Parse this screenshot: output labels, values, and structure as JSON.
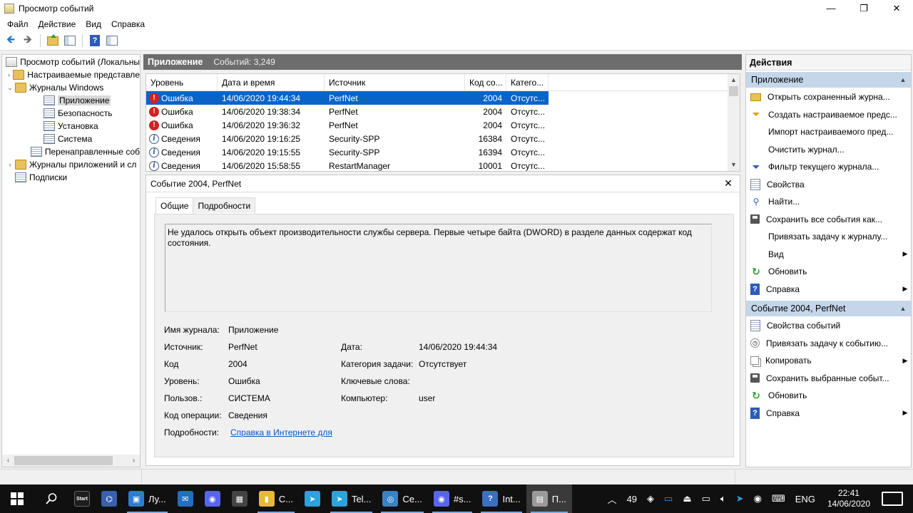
{
  "window": {
    "title": "Просмотр событий",
    "minimize": "—",
    "restore": "❐",
    "close": "✕"
  },
  "menu": [
    "Файл",
    "Действие",
    "Вид",
    "Справка"
  ],
  "toolbar": {
    "back_icon": "arrow-left-icon",
    "forward_icon": "arrow-right-icon",
    "back_glyph": "🡸",
    "forward_glyph": "🡺",
    "help_glyph": "?"
  },
  "tree": {
    "items": [
      {
        "label": "Просмотр событий (Локальны",
        "exp": "",
        "icon": "root",
        "indent": 0
      },
      {
        "label": "Настраиваемые представле",
        "exp": "›",
        "icon": "folder",
        "indent": 1
      },
      {
        "label": "Журналы Windows",
        "exp": "⌄",
        "icon": "folder",
        "indent": 1
      },
      {
        "label": "Приложение",
        "exp": "",
        "icon": "log",
        "indent": 2,
        "selected": true
      },
      {
        "label": "Безопасность",
        "exp": "",
        "icon": "log",
        "indent": 2
      },
      {
        "label": "Установка",
        "exp": "",
        "icon": "log",
        "indent": 2
      },
      {
        "label": "Система",
        "exp": "",
        "icon": "log",
        "indent": 2
      },
      {
        "label": "Перенаправленные соб",
        "exp": "",
        "icon": "log",
        "indent": 2
      },
      {
        "label": "Журналы приложений и сл",
        "exp": "›",
        "icon": "folder",
        "indent": 1
      },
      {
        "label": "Подписки",
        "exp": "",
        "icon": "log",
        "indent": 1
      }
    ],
    "scroll_left": "‹",
    "scroll_right": "›"
  },
  "center": {
    "title": "Приложение",
    "count": "Событий: 3,249"
  },
  "grid": {
    "columns": [
      "Уровень",
      "Дата и время",
      "Источник",
      "Код со...",
      "Катего..."
    ],
    "rows": [
      {
        "level": "Ошибка",
        "type": "err",
        "datetime": "14/06/2020 19:44:34",
        "source": "PerfNet",
        "code": "2004",
        "category": "Отсутс...",
        "selected": true
      },
      {
        "level": "Ошибка",
        "type": "err",
        "datetime": "14/06/2020 19:38:34",
        "source": "PerfNet",
        "code": "2004",
        "category": "Отсутс..."
      },
      {
        "level": "Ошибка",
        "type": "err",
        "datetime": "14/06/2020 19:36:32",
        "source": "PerfNet",
        "code": "2004",
        "category": "Отсутс..."
      },
      {
        "level": "Сведения",
        "type": "info",
        "datetime": "14/06/2020 19:16:25",
        "source": "Security-SPP",
        "code": "16384",
        "category": "Отсутс..."
      },
      {
        "level": "Сведения",
        "type": "info",
        "datetime": "14/06/2020 19:15:55",
        "source": "Security-SPP",
        "code": "16394",
        "category": "Отсутс..."
      },
      {
        "level": "Сведения",
        "type": "info",
        "datetime": "14/06/2020 15:58:55",
        "source": "RestartManager",
        "code": "10001",
        "category": "Отсутс..."
      }
    ],
    "scroll_up": "▲",
    "scroll_down": "▼"
  },
  "detail": {
    "title": "Событие 2004, PerfNet",
    "close": "✕",
    "tabs": [
      "Общие",
      "Подробности"
    ],
    "description": "Не удалось открыть объект производительности службы сервера. Первые четыре байта (DWORD) в разделе данных содержат код состояния.",
    "fields": {
      "log_name_label": "Имя журнала:",
      "log_name": "Приложение",
      "source_label": "Источник:",
      "source": "PerfNet",
      "date_label": "Дата:",
      "date": "14/06/2020 19:44:34",
      "code_label": "Код",
      "code": "2004",
      "task_cat_label": "Категория задачи:",
      "task_cat": "Отсутствует",
      "level_label": "Уровень:",
      "level": "Ошибка",
      "keywords_label": "Ключевые слова:",
      "user_label": "Пользов.:",
      "user": "СИСТЕМА",
      "computer_label": "Компьютер:",
      "computer": "user",
      "opcode_label": "Код операции:",
      "opcode": "Сведения",
      "more_label": "Подробности:",
      "more_link": "Справка в Интернете для"
    }
  },
  "actions": {
    "title": "Действия",
    "section1": "Приложение",
    "section1_items": [
      {
        "label": "Открыть сохраненный журна...",
        "icon": "open",
        "name": "open-saved-log"
      },
      {
        "label": "Создать настраиваемое предс...",
        "icon": "funnel-y",
        "name": "create-custom-view"
      },
      {
        "label": "Импорт настраиваемого пред...",
        "icon": "none",
        "name": "import-custom-view"
      },
      {
        "label": "Очистить журнал...",
        "icon": "none",
        "name": "clear-log"
      },
      {
        "label": "Фильтр текущего журнала...",
        "icon": "funnel",
        "name": "filter-current-log"
      },
      {
        "label": "Свойства",
        "icon": "doc",
        "name": "properties"
      },
      {
        "label": "Найти...",
        "icon": "bino",
        "name": "find"
      },
      {
        "label": "Сохранить все события как...",
        "icon": "save",
        "name": "save-all-events"
      },
      {
        "label": "Привязать задачу к журналу...",
        "icon": "none",
        "name": "attach-task-log"
      },
      {
        "label": "Вид",
        "icon": "none",
        "name": "view",
        "sub": true
      },
      {
        "label": "Обновить",
        "icon": "refresh",
        "name": "refresh"
      },
      {
        "label": "Справка",
        "icon": "help",
        "name": "help",
        "sub": true
      }
    ],
    "section2": "Событие 2004, PerfNet",
    "section2_items": [
      {
        "label": "Свойства событий",
        "icon": "doc",
        "name": "event-properties"
      },
      {
        "label": "Привязать задачу к событию...",
        "icon": "task",
        "name": "attach-task-event"
      },
      {
        "label": "Копировать",
        "icon": "copy",
        "name": "copy",
        "sub": true
      },
      {
        "label": "Сохранить выбранные событ...",
        "icon": "save",
        "name": "save-selected-events"
      },
      {
        "label": "Обновить",
        "icon": "refresh",
        "name": "refresh-2"
      },
      {
        "label": "Справка",
        "icon": "help",
        "name": "help-2",
        "sub": true
      }
    ],
    "collapse_glyph": "▲",
    "submenu_glyph": "▶"
  },
  "taskbar": {
    "apps": [
      {
        "name": "start-menu-app",
        "label": "",
        "color": "#1e1e1e",
        "glyph": "Start"
      },
      {
        "name": "network-app",
        "label": "",
        "color": "#3a5fb0",
        "glyph": "⌬"
      },
      {
        "name": "explorer-app-1",
        "label": "Лу...",
        "color": "#2d7dd2",
        "glyph": "▣"
      },
      {
        "name": "mail-app",
        "label": "",
        "color": "#1f6fc5",
        "glyph": "✉"
      },
      {
        "name": "discord-app-1",
        "label": "",
        "color": "#5865f2",
        "glyph": "◉"
      },
      {
        "name": "calculator-app",
        "label": "",
        "color": "#444444",
        "glyph": "▦"
      },
      {
        "name": "folder-app",
        "label": "С...",
        "color": "#e8b83a",
        "glyph": "▮"
      },
      {
        "name": "telegram-app-1",
        "label": "",
        "color": "#2aa3df",
        "glyph": "➤"
      },
      {
        "name": "telegram-app-2",
        "label": "Tel...",
        "color": "#2aa3df",
        "glyph": "➤"
      },
      {
        "name": "chrome-app",
        "label": "Се...",
        "color": "#3b82c4",
        "glyph": "◎"
      },
      {
        "name": "discord-app-2",
        "label": "#s...",
        "color": "#5865f2",
        "glyph": "◉"
      },
      {
        "name": "help-app",
        "label": "Int...",
        "color": "#3a6fc4",
        "glyph": "?"
      },
      {
        "name": "event-viewer-app",
        "label": "П...",
        "color": "#9a9a9a",
        "glyph": "▤",
        "active": true
      }
    ],
    "tray": {
      "chevron": "︿",
      "temp": "49",
      "lang": "ENG",
      "time": "22:41",
      "date": "14/06/2020"
    }
  }
}
